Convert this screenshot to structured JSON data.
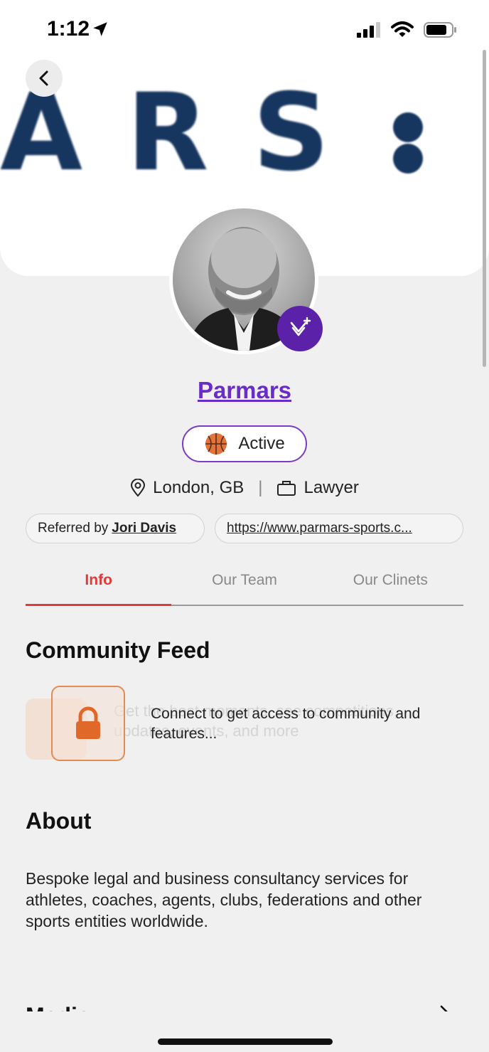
{
  "status_bar": {
    "time": "1:12",
    "icons": [
      "location-arrow-icon",
      "cellular-signal-icon",
      "wifi-icon",
      "battery-icon"
    ]
  },
  "banner": {
    "logo_text": "ARS"
  },
  "profile": {
    "name": "Parmars",
    "status": "Active",
    "location": "London, GB",
    "profession": "Lawyer",
    "referred_prefix": "Referred by",
    "referred_name": "Jori Davis",
    "website": "https://www.parmars-sports.c..."
  },
  "tabs": [
    {
      "label": "Info",
      "active": true
    },
    {
      "label": "Our Team",
      "active": false
    },
    {
      "label": "Our Clinets",
      "active": false
    }
  ],
  "community_feed": {
    "title": "Community Feed",
    "ghost_text_line1": "Get the best moments, see competitions,",
    "ghost_text_line2": "updates, events, and more",
    "locked_message": "Connect to get access to community and features..."
  },
  "about": {
    "title": "About",
    "text": "Bespoke legal and business consultancy services for athletes, coaches, agents, clubs, federations and other sports entities worldwide."
  },
  "media": {
    "title": "Media"
  },
  "colors": {
    "brand_purple": "#6a2cc9",
    "active_tab_red": "#e03a3a",
    "lock_orange": "#e0692a",
    "logo_navy": "#17365f"
  }
}
